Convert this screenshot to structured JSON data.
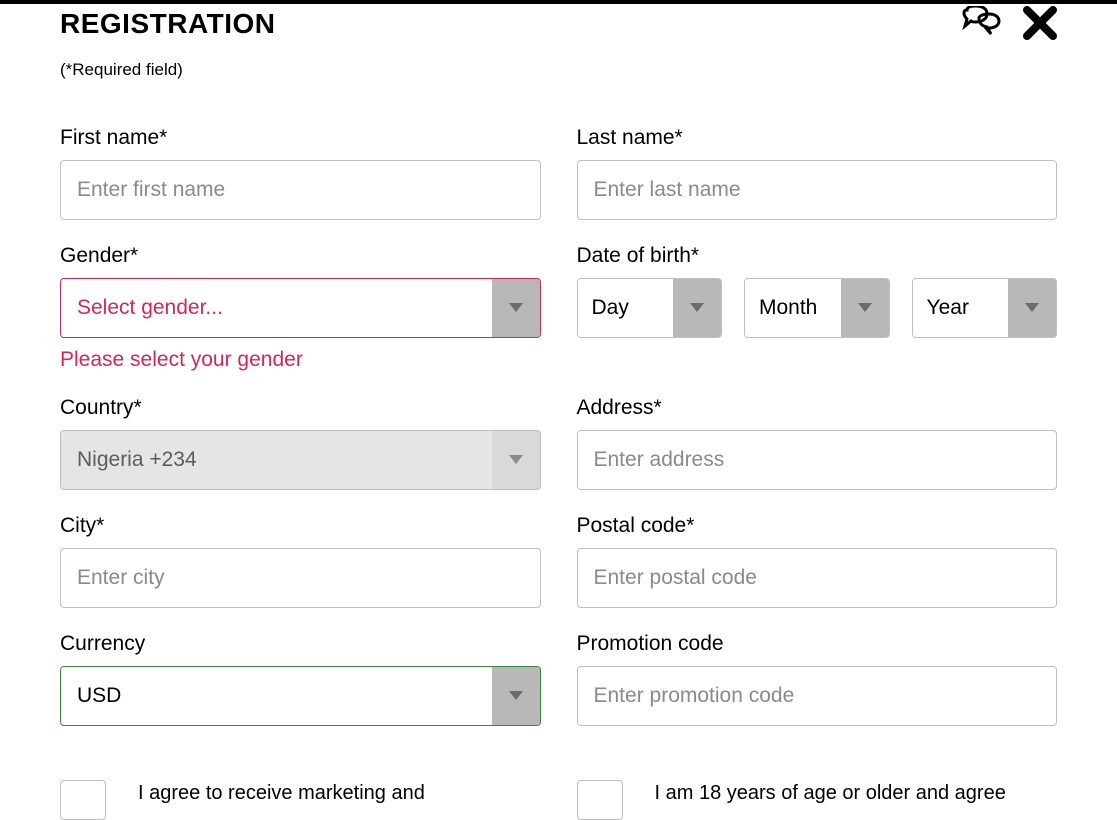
{
  "header": {
    "title": "REGISTRATION",
    "required_note": "(*Required field)"
  },
  "fields": {
    "first_name": {
      "label": "First name*",
      "placeholder": "Enter first name"
    },
    "last_name": {
      "label": "Last name*",
      "placeholder": "Enter last name"
    },
    "gender": {
      "label": "Gender*",
      "placeholder": "Select gender...",
      "error": "Please select your gender"
    },
    "dob": {
      "label": "Date of birth*",
      "day": "Day",
      "month": "Month",
      "year": "Year"
    },
    "country": {
      "label": "Country*",
      "value": "Nigeria +234"
    },
    "address": {
      "label": "Address*",
      "placeholder": "Enter address"
    },
    "city": {
      "label": "City*",
      "placeholder": "Enter city"
    },
    "postal": {
      "label": "Postal code*",
      "placeholder": "Enter postal code"
    },
    "currency": {
      "label": "Currency",
      "value": "USD"
    },
    "promo": {
      "label": "Promotion code",
      "placeholder": "Enter promotion code"
    }
  },
  "checks": {
    "marketing": "I agree to receive marketing and",
    "age": "I am 18 years of age or older and agree"
  }
}
